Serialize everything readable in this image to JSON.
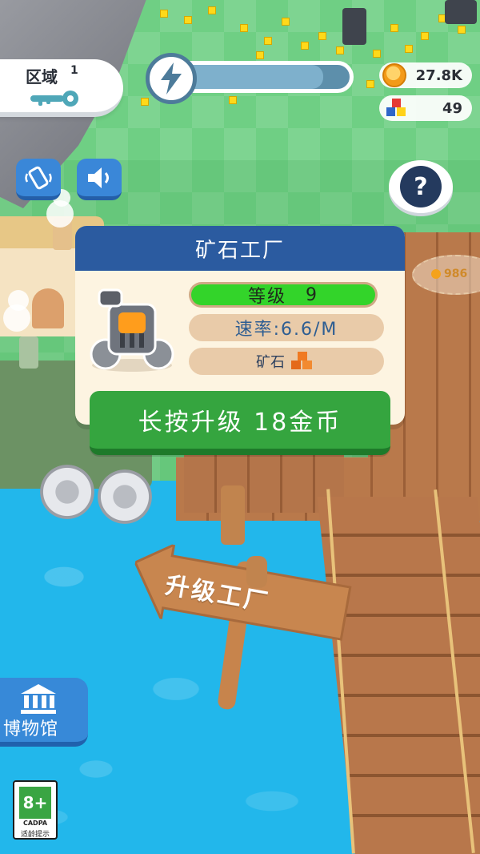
{
  "hud": {
    "zone_label": "区域",
    "zone_number": "1",
    "energy_fill": 0.85,
    "coins": "27.8K",
    "blocks": "49"
  },
  "ground_coin_amount": "986",
  "factory_panel": {
    "title": "矿石工厂",
    "level_label": "等级",
    "level_value": "9",
    "rate_text": "速率:6.6/M",
    "product_label": "矿石"
  },
  "upgrade_button": {
    "label": "长按升级 18金币"
  },
  "signpost_text": "升级工厂",
  "museum_label": "博物馆",
  "age_rating": {
    "age": "8+",
    "org": "CADPA",
    "hint": "适龄提示"
  },
  "colors": {
    "panel_header": "#2b5ba0",
    "level_fill": "#33d42a",
    "upgrade_button": "#35a53f",
    "hud_button": "#3a87d8"
  }
}
